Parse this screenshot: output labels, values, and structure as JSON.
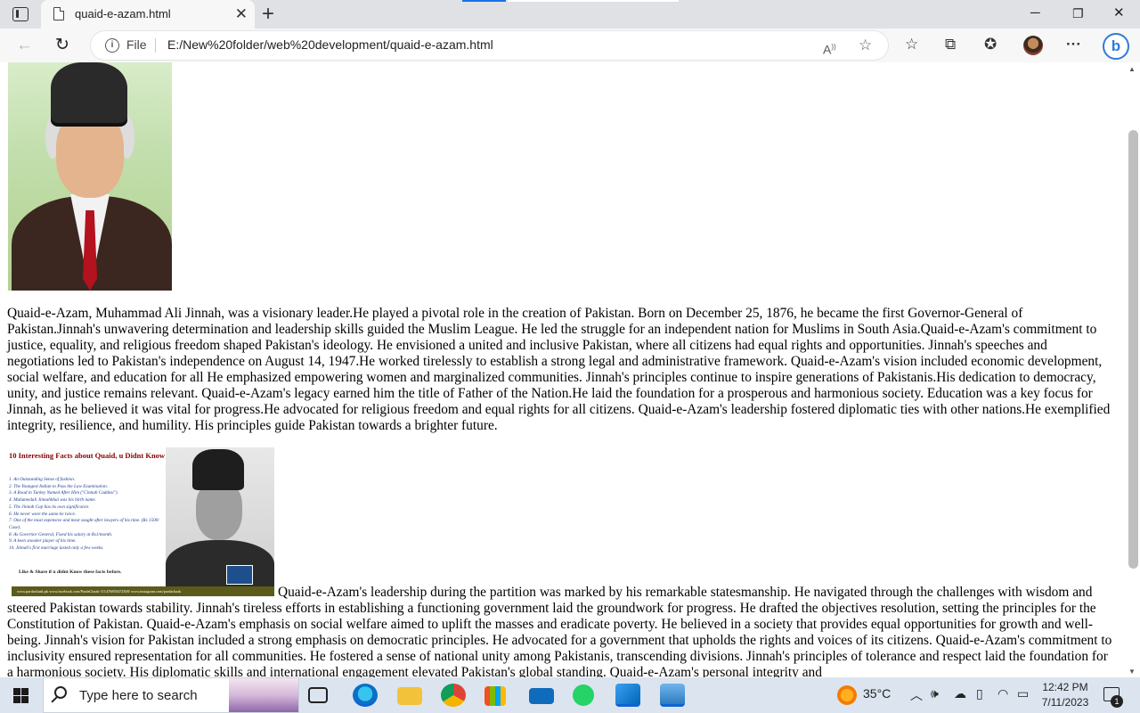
{
  "browser": {
    "tab_title": "quaid-e-azam.html",
    "new_tab_symbol": "+",
    "address_scheme": "File",
    "url": "E:/New%20folder/web%20development/quaid-e-azam.html"
  },
  "page": {
    "paragraph_1": "Quaid-e-Azam, Muhammad Ali Jinnah, was a visionary leader.He played a pivotal role in the creation of Pakistan. Born on December 25, 1876, he became the first Governor-General of Pakistan.Jinnah's unwavering determination and leadership skills guided the Muslim League. He led the struggle for an independent nation for Muslims in South Asia.Quaid-e-Azam's commitment to justice, equality, and religious freedom shaped Pakistan's ideology. He envisioned a united and inclusive Pakistan, where all citizens had equal rights and opportunities. Jinnah's speeches and negotiations led to Pakistan's independence on August 14, 1947.He worked tirelessly to establish a strong legal and administrative framework. Quaid-e-Azam's vision included economic development, social welfare, and education for all He emphasized empowering women and marginalized communities. Jinnah's principles continue to inspire generations of Pakistanis.His dedication to democracy, unity, and justice remains relevant. Quaid-e-Azam's legacy earned him the title of Father of the Nation.He laid the foundation for a prosperous and harmonious society. Education was a key focus for Jinnah, as he believed it was vital for progress.He advocated for religious freedom and equal rights for all citizens. Quaid-e-Azam's leadership fostered diplomatic ties with other nations.He exemplified integrity, resilience, and humility. His principles guide Pakistan towards a brighter future.",
    "poster": {
      "title": "10 Interesting Facts about Quaid, u Didnt Know",
      "facts": [
        "1. An Outstanding Sense of fashion.",
        "2. The Youngest Indian to Pass the Law Examination.",
        "3. A Road in Turkey Named After Him (\"Cinnah Caddesi\").",
        "4. Muhamedali Jinnahbhai was his birth name.",
        "5. The Jinnah Cap has its own significance.",
        "6. He never wore the same tie twice.",
        "7. One of the most expensive and most sought after lawyers of his time. (Rs 1500/ Case).",
        "8. As Governor General, Fixed his salary at Rs1/month.",
        "9. A keen snooker player of his time.",
        "10. Jinnah's first marriage lasted only a few weeks."
      ],
      "share_line": "Like & Share if u didnt Know these facts before.",
      "footer": "www.pardachaak.pk   www.facebook.com/PardaChaak-111476850472308/   www.instagram.com/pardachaak"
    },
    "paragraph_2": "Quaid-e-Azam's leadership during the partition was marked by his remarkable statesmanship. He navigated through the challenges with wisdom and steered Pakistan towards stability. Jinnah's tireless efforts in establishing a functioning government laid the groundwork for progress. He drafted the objectives resolution, setting the principles for the Constitution of Pakistan. Quaid-e-Azam's emphasis on social welfare aimed to uplift the masses and eradicate poverty. He believed in a society that provides equal opportunities for growth and well-being. Jinnah's vision for Pakistan included a strong emphasis on democratic principles. He advocated for a government that upholds the rights and voices of its citizens. Quaid-e-Azam's commitment to inclusivity ensured representation for all communities. He fostered a sense of national unity among Pakistanis, transcending divisions. Jinnah's principles of tolerance and respect laid the foundation for a harmonious society. His diplomatic skills and international engagement elevated Pakistan's global standing. Quaid-e-Azam's personal integrity and"
  },
  "taskbar": {
    "search_placeholder": "Type here to search",
    "temperature": "35°C",
    "time": "12:42 PM",
    "date": "7/11/2023",
    "notification_count": "1"
  },
  "colors": {
    "accent": "#1a73e8",
    "taskbar_bg": "#dce5ef",
    "tab_strip": "#dfe1e5"
  }
}
